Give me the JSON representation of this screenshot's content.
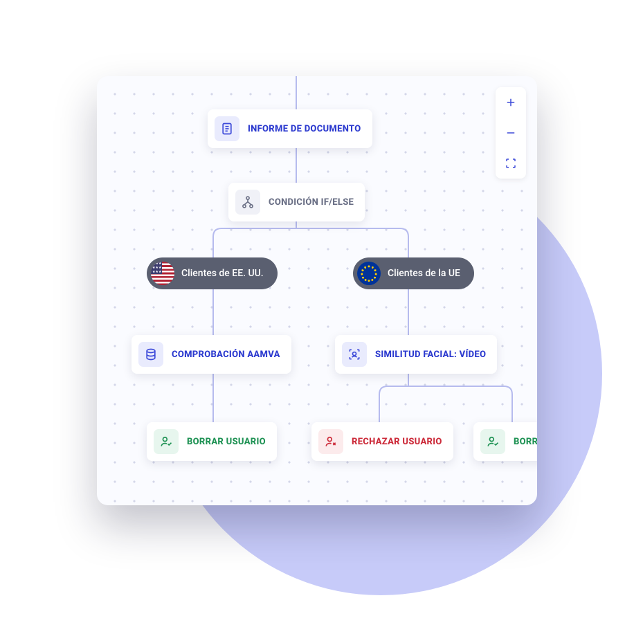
{
  "nodes": {
    "document_report": {
      "label": "INFORME DE DOCUMENTO"
    },
    "condition": {
      "label": "CONDICIÓN IF/ELSE"
    },
    "branch_us": {
      "label": "Clientes de EE. UU."
    },
    "branch_eu": {
      "label": "Clientes de la UE"
    },
    "aamva": {
      "label": "COMPROBACIÓN AAMVA"
    },
    "facial": {
      "label": "SIMILITUD FACIAL: VÍDEO"
    },
    "clear_user_left": {
      "label": "BORRAR USUARIO"
    },
    "reject_user": {
      "label": "RECHAZAR USUARIO"
    },
    "clear_user_right": {
      "label": "BORRAR USUARIO"
    }
  },
  "controls": {
    "zoom_in": "+",
    "zoom_out": "−",
    "fullscreen": "⛶"
  }
}
